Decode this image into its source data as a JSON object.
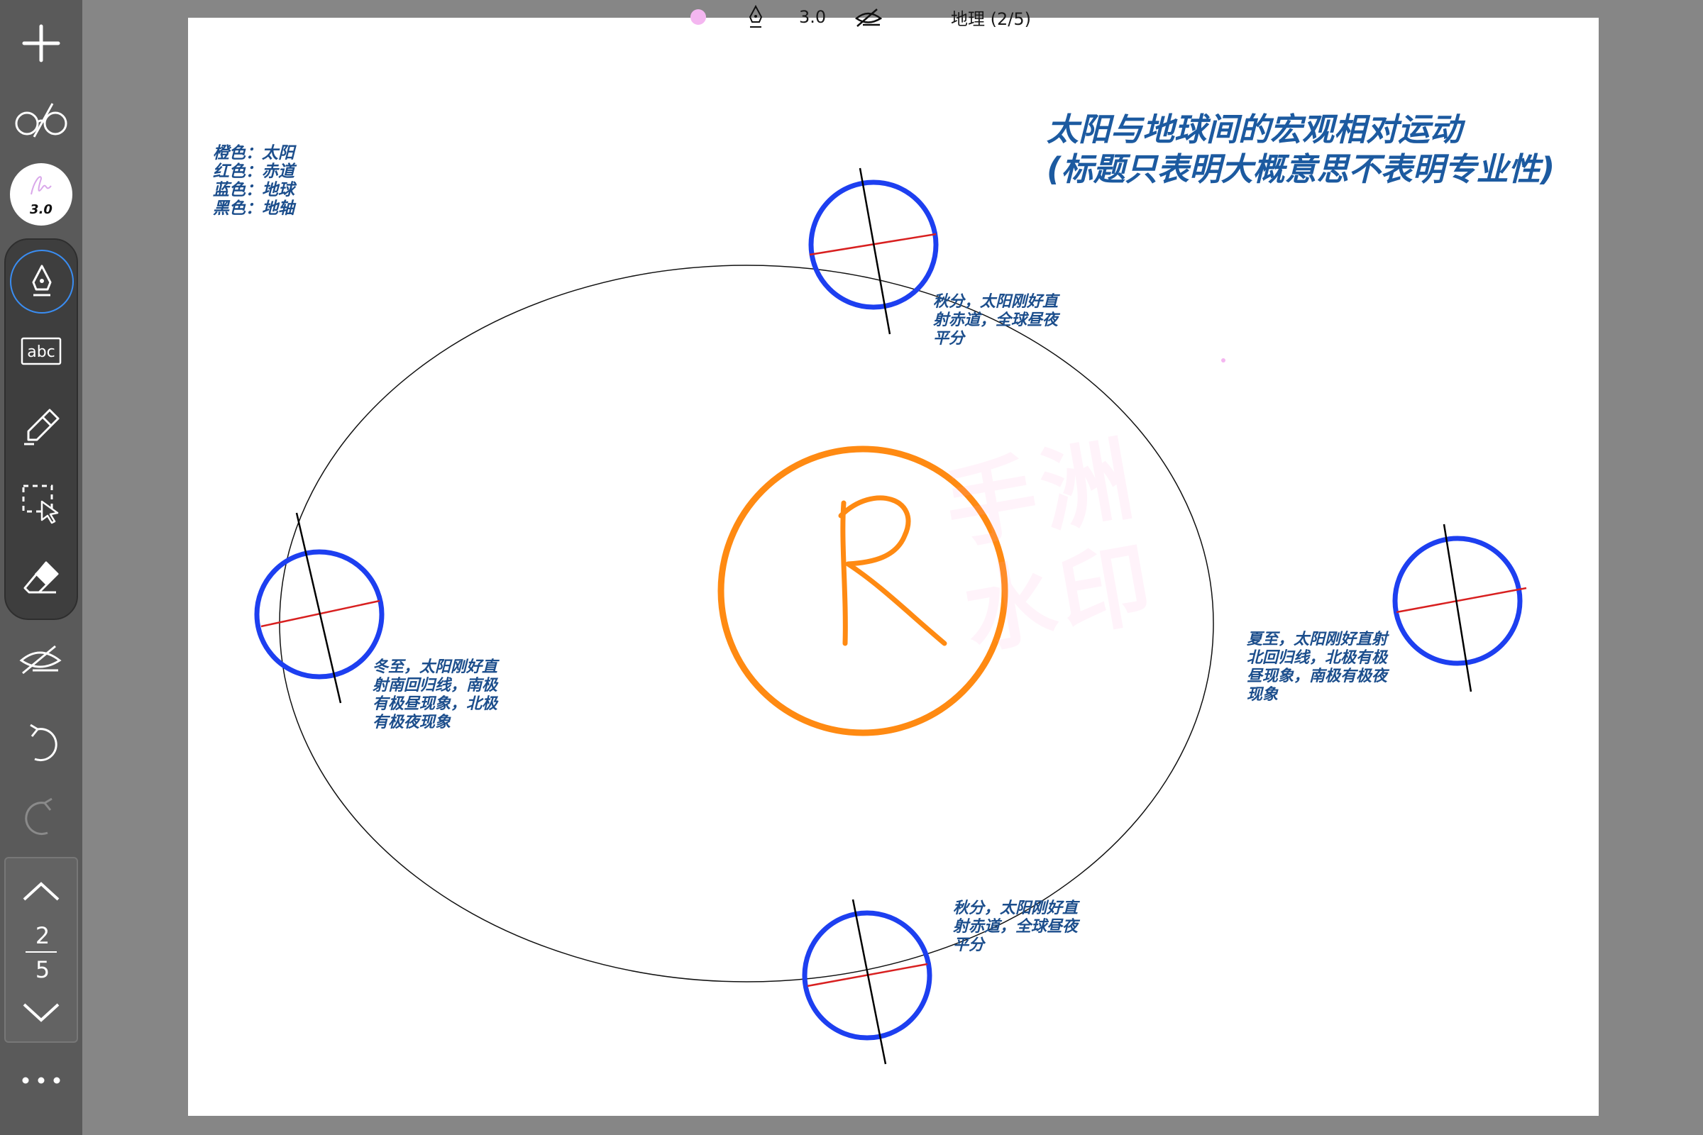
{
  "toolbar": {
    "new_icon": "plus-icon",
    "view_icon": "glasses-icon",
    "pen_width_label": "3.0",
    "tools": [
      "pen-icon",
      "text-box-icon",
      "highlighter-icon",
      "lasso-select-icon",
      "eraser-icon"
    ],
    "hide_ink_icon": "hide-ink-icon",
    "undo_icon": "undo-icon",
    "redo_icon": "redo-icon",
    "more_icon": "more-icon"
  },
  "pager": {
    "current": "2",
    "total": "5"
  },
  "status": {
    "pen_width": "3.0",
    "doc_title": "地理 (2/5)",
    "pen_color": "#f4b6f0"
  },
  "canvas": {
    "legend": [
      "橙色：太阳",
      "红色：赤道",
      "蓝色：地球",
      "黑色：地轴"
    ],
    "title_line1": "太阳与地球间的宏观相对运动",
    "title_line2": "(标题只表明大概意思不表明专业性)",
    "sun_letter": "R",
    "watermark": [
      "手洲",
      "水印"
    ],
    "notes": {
      "top": [
        "秋分，太阳刚好直",
        "射赤道，全球昼夜",
        "平分"
      ],
      "left": [
        "冬至，太阳刚好直",
        "射南回归线，南极",
        "有极昼现象，北极",
        "有极夜现象"
      ],
      "right": [
        "夏至，太阳刚好直射",
        "北回归线，北极有极",
        "昼现象，南极有极夜",
        "现象"
      ],
      "bottom": [
        "秋分，太阳刚好直",
        "射赤道，全球昼夜",
        "平分"
      ]
    }
  },
  "colors": {
    "sun": "#ff8a12",
    "earth": "#1d3ff0",
    "equator": "#d82020",
    "axis": "#000000",
    "text": "#1c4e8c"
  }
}
